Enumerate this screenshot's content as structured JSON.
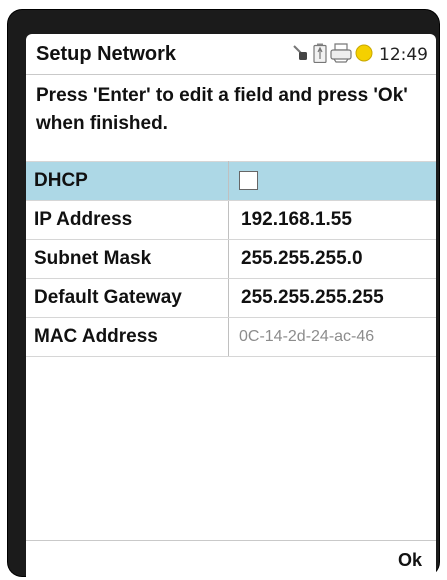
{
  "header": {
    "title": "Setup Network",
    "time": "12:49",
    "status_icons": [
      "plug-icon",
      "battery-icon",
      "printer-icon",
      "status-light-icon"
    ]
  },
  "instructions": "Press 'Enter' to edit a field and press 'Ok' when finished.",
  "fields": [
    {
      "label": "DHCP",
      "type": "checkbox",
      "checked": false,
      "selected": true
    },
    {
      "label": "IP Address",
      "value": "192.168.1.55"
    },
    {
      "label": "Subnet Mask",
      "value": "255.255.255.0"
    },
    {
      "label": "Default Gateway",
      "value": "255.255.255.255"
    },
    {
      "label": "MAC Address",
      "value": "0C-14-2d-24-ac-46",
      "readonly": true
    }
  ],
  "softkeys": {
    "ok": "Ok"
  },
  "colors": {
    "selection": "#add8e6",
    "status_light": "#f5d000"
  }
}
